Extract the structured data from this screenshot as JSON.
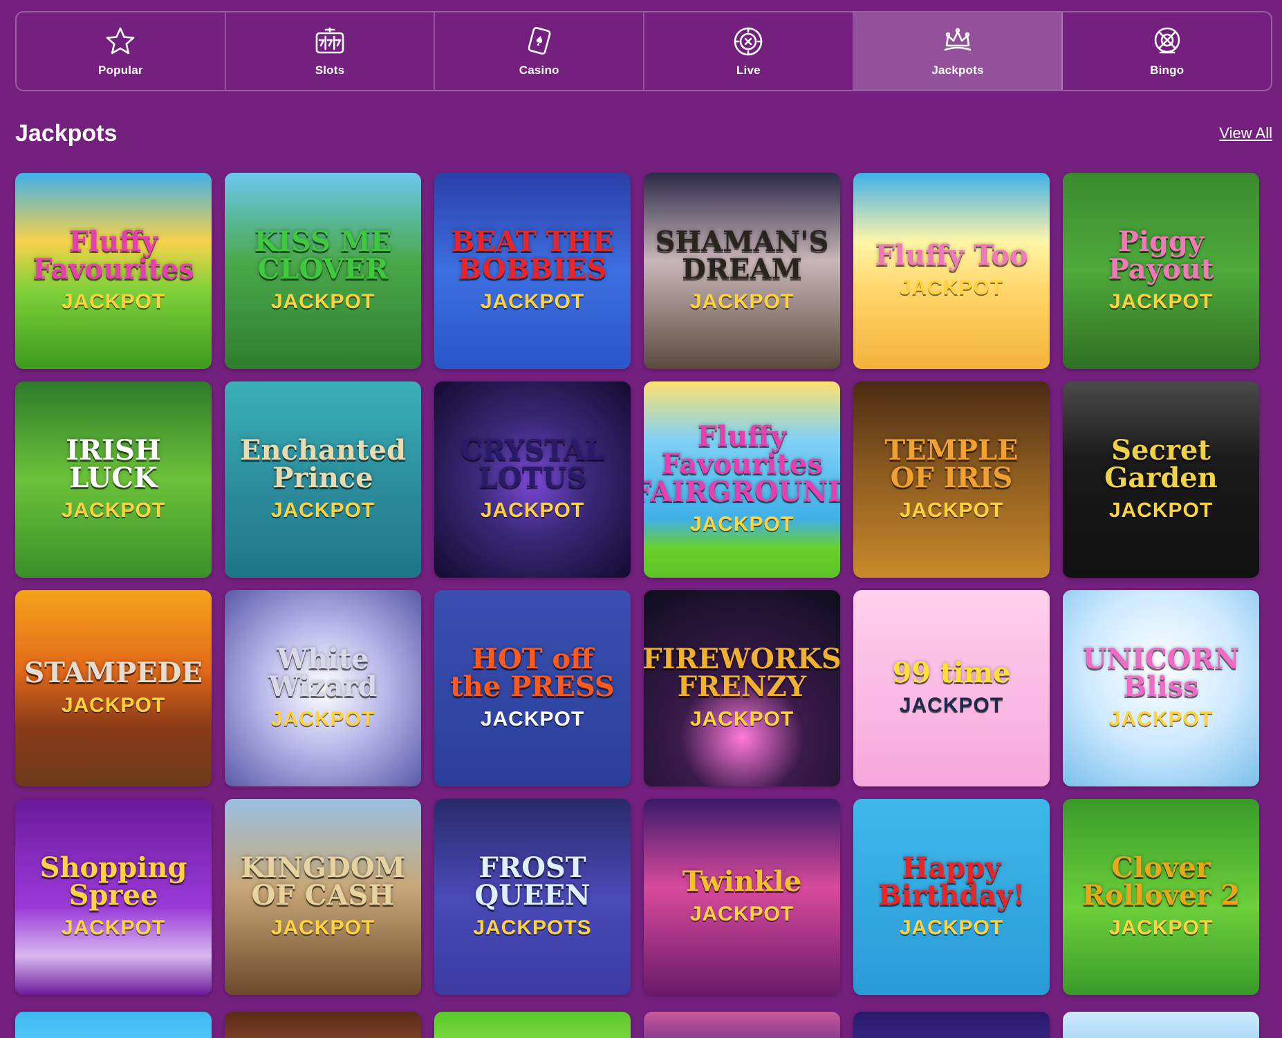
{
  "nav": {
    "items": [
      {
        "label": "Popular",
        "icon": "star-icon",
        "active": false
      },
      {
        "label": "Slots",
        "icon": "slot-machine-icon",
        "active": false
      },
      {
        "label": "Casino",
        "icon": "playing-card-icon",
        "active": false
      },
      {
        "label": "Live",
        "icon": "live-chip-icon",
        "active": false
      },
      {
        "label": "Jackpots",
        "icon": "crown-icon",
        "active": true
      },
      {
        "label": "Bingo",
        "icon": "bingo-ball-icon",
        "active": false
      }
    ]
  },
  "section": {
    "title": "Jackpots",
    "view_all": "View All"
  },
  "games": [
    {
      "title": "Fluffy Favourites",
      "sub": "JACKPOT",
      "bg": "linear-gradient(180deg,#3fb0e8 0%,#f7d24a 35%,#7fd13a 60%,#3c9a1e 100%)",
      "tc": "#e83fb0",
      "sc": "#ffd23f"
    },
    {
      "title": "KISS ME CLOVER",
      "sub": "JACKPOT",
      "bg": "linear-gradient(180deg,#6cc8f0 0%,#4aa94a 45%,#2f7d2f 100%)",
      "tc": "#3ec93e",
      "sc": "#ffd23f"
    },
    {
      "title": "BEAT THE BOBBIES",
      "sub": "JACKPOT",
      "bg": "linear-gradient(180deg,#2a3fa8 0%,#3d6fe0 50%,#2a55c7 100%)",
      "tc": "#e8262a",
      "sc": "#ffd23f"
    },
    {
      "title": "SHAMAN'S DREAM",
      "sub": "JACKPOT",
      "bg": "linear-gradient(180deg,#2b2a47 0%,#c9b6b8 45%,#5a4a3d 100%)",
      "tc": "#2a241e",
      "sc": "#ffd23f"
    },
    {
      "title": "Fluffy Too",
      "sub": "JACKPOT",
      "bg": "linear-gradient(180deg,#3fb0e8 0%,#fff6a8 35%,#ffd66a 60%,#f3b23a 100%)",
      "tc": "#f07ab9",
      "sc": "#ffd23f"
    },
    {
      "title": "Piggy Payout",
      "sub": "JACKPOT",
      "bg": "linear-gradient(180deg,#3a8a2e 0%,#4eaa3a 50%,#2f6e24 100%)",
      "tc": "#f07ab9",
      "sc": "#ffd23f"
    },
    {
      "title": "IRISH LUCK",
      "sub": "JACKPOT",
      "bg": "linear-gradient(180deg,#2f7a2a 0%,#6cc23a 50%,#3a8f2a 100%)",
      "tc": "#ffffff",
      "sc": "#ffd23f"
    },
    {
      "title": "Enchanted Prince",
      "sub": "JACKPOT",
      "bg": "linear-gradient(180deg,#3ab0b8 0%,#2d8f9e 50%,#1f7488 100%)",
      "tc": "#e9dbb0",
      "sc": "#ffd23f"
    },
    {
      "title": "CRYSTAL LOTUS",
      "sub": "JACKPOT",
      "bg": "radial-gradient(circle at 50% 50%,#7a4ad8 0%,#3b2a7a 40%,#120b2e 100%)",
      "tc": "#2a1a6a",
      "sc": "#ffd23f"
    },
    {
      "title": "Fluffy Favourites FAIRGROUND",
      "sub": "JACKPOT",
      "bg": "linear-gradient(180deg,#ffe070 0%,#7fd1f5 30%,#3fb0e8 70%,#6bd02a 85%,#5cc22a 100%)",
      "tc": "#e83fb0",
      "sc": "#ffd23f"
    },
    {
      "title": "TEMPLE OF IRIS",
      "sub": "JACKPOT",
      "bg": "linear-gradient(180deg,#4a2b12 0%,#8a5a20 45%,#c88a2a 100%)",
      "tc": "#f2a030",
      "sc": "#ffd23f"
    },
    {
      "title": "Secret Garden",
      "sub": "JACKPOT",
      "bg": "linear-gradient(180deg,#4a4a4a 0%,#1a1a1a 40%,#111 100%)",
      "tc": "#f0d24a",
      "sc": "#ffd23f"
    },
    {
      "title": "STAMPEDE",
      "sub": "JACKPOT",
      "bg": "linear-gradient(180deg,#f5a31c 0%,#e36a1a 40%,#8a3a18 70%,#6b3a1a 100%)",
      "tc": "#e6ddd0",
      "sc": "#ffd23f"
    },
    {
      "title": "White Wizard",
      "sub": "JACKPOT",
      "bg": "radial-gradient(circle at 50% 50%,#ffffff 0%,#b8b8ea 45%,#5a5aa8 100%)",
      "tc": "#d8d8e8",
      "sc": "#ffd23f"
    },
    {
      "title": "HOT off the PRESS",
      "sub": "JACKPOT",
      "bg": "linear-gradient(180deg,#3a4fb0 0%,#2b3e9a 100%)",
      "tc": "#ff5a1a",
      "sc": "#ffffff"
    },
    {
      "title": "FIREWORKS FRENZY",
      "sub": "JACKPOT",
      "bg": "radial-gradient(circle at 50% 75%,#ff7ad8 0%,#3a1a4a 35%,#0e0e1e 100%)",
      "tc": "#f2b030",
      "sc": "#ffd23f"
    },
    {
      "title": "99 time",
      "sub": "JACKPOT",
      "bg": "linear-gradient(180deg,#ffd0ec 0%,#f5a8dc 100%)",
      "tc": "#ffe03a",
      "sc": "#1e2a4a"
    },
    {
      "title": "UNICORN Bliss",
      "sub": "JACKPOT",
      "bg": "radial-gradient(circle at 50% 40%,#ffffff 0%,#cfeaff 50%,#7ac0ea 100%)",
      "tc": "#f06ac8",
      "sc": "#ffd23f"
    },
    {
      "title": "Shopping Spree",
      "sub": "JACKPOT",
      "bg": "linear-gradient(180deg,#6a1a9a 0%,#9a3ad8 55%,#d8b8f0 80%,#6a1a9a 100%)",
      "tc": "#ffd23f",
      "sc": "#ffd23f"
    },
    {
      "title": "KINGDOM OF CASH",
      "sub": "JACKPOT",
      "bg": "linear-gradient(180deg,#9ac0e0 0%,#c8a878 45%,#6a4a2a 100%)",
      "tc": "#e6d3a0",
      "sc": "#ffd23f"
    },
    {
      "title": "FROST QUEEN",
      "sub": "JACKPOTS",
      "bg": "linear-gradient(180deg,#2a2a6a 0%,#4a4ab8 50%,#3a3aa0 100%)",
      "tc": "#dcf0ff",
      "sc": "#ffd23f"
    },
    {
      "title": "Twinkle",
      "sub": "JACKPOT",
      "bg": "linear-gradient(180deg,#3a1a6a 0%,#d84a9a 45%,#6a1a6a 100%)",
      "tc": "#f2c030",
      "sc": "#ffd23f"
    },
    {
      "title": "Happy Birthday!",
      "sub": "JACKPOT",
      "bg": "linear-gradient(180deg,#3fb8e8 0%,#2a9ad8 100%)",
      "tc": "#e8262a",
      "sc": "#ffd23f"
    },
    {
      "title": "Clover Rollover 2",
      "sub": "JACKPOT",
      "bg": "linear-gradient(180deg,#3a9a2a 0%,#6cd03a 55%,#3a9a2a 100%)",
      "tc": "#e8a81a",
      "sc": "#ffd23f"
    }
  ],
  "partial_row": [
    {
      "bg": "linear-gradient(180deg,#3fb8f0 0%,#5ad0ff 100%)"
    },
    {
      "bg": "linear-gradient(180deg,#5a2a1a 0%,#8a4a2a 100%)"
    },
    {
      "bg": "linear-gradient(180deg,#5ac82a 0%,#8ae04a 100%)"
    },
    {
      "bg": "linear-gradient(180deg,#c85a9a 0%,#6a2a8a 100%)"
    },
    {
      "bg": "linear-gradient(180deg,#2a1a6a 0%,#3a2a8a 100%)"
    },
    {
      "bg": "linear-gradient(180deg,#cfeaff 0%,#9ad0f0 100%)"
    }
  ]
}
